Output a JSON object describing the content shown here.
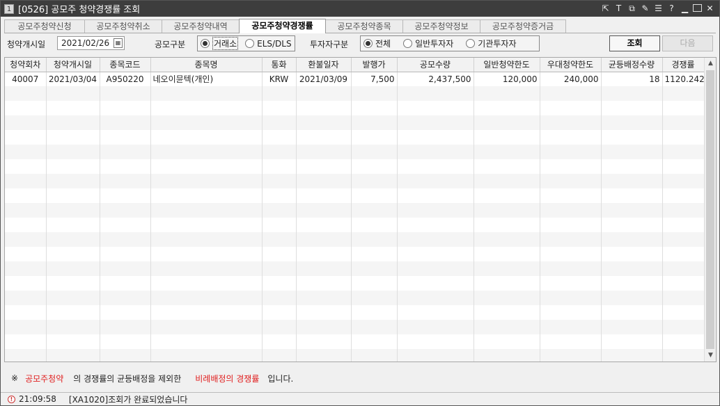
{
  "window": {
    "number": "1",
    "title": "[0526] 공모주 청약경쟁률 조회",
    "controls": [
      "link-out-icon",
      "text-icon",
      "copy-icon",
      "edit-icon",
      "list-icon",
      "help-icon",
      "minimize-icon",
      "maximize-icon",
      "close-icon"
    ]
  },
  "tabs": [
    {
      "label": "공모주청약신청",
      "active": false
    },
    {
      "label": "공모주청약취소",
      "active": false
    },
    {
      "label": "공모주청약내역",
      "active": false
    },
    {
      "label": "공모주청약경쟁률",
      "active": true
    },
    {
      "label": "공모주청약종목",
      "active": false
    },
    {
      "label": "공모주청약정보",
      "active": false
    },
    {
      "label": "공모주청약증거금",
      "active": false
    }
  ],
  "filters": {
    "start_date_label": "청약개시일",
    "start_date_value": "2021/02/26",
    "offer_type_label": "공모구분",
    "offer_type_options": [
      {
        "label": "거래소",
        "selected": true
      },
      {
        "label": "ELS/DLS",
        "selected": false
      }
    ],
    "investor_type_label": "투자자구분",
    "investor_type_options": [
      {
        "label": "전체",
        "selected": true
      },
      {
        "label": "일반투자자",
        "selected": false
      },
      {
        "label": "기관투자자",
        "selected": false
      }
    ],
    "search_button": "조회",
    "next_button": "다음"
  },
  "grid": {
    "columns": [
      "청약회차",
      "청약개시일",
      "종목코드",
      "종목명",
      "통화",
      "환불일자",
      "발행가",
      "공모수량",
      "일반청약한도",
      "우대청약한도",
      "균등배정수량",
      "경쟁률"
    ],
    "rows": [
      [
        "40007",
        "2021/03/04",
        "A950220",
        "네오이뮨텍(개인)",
        "KRW",
        "2021/03/09",
        "7,500",
        "2,437,500",
        "120,000",
        "240,000",
        "18",
        "1120.242"
      ]
    ]
  },
  "notice": {
    "mark": "※",
    "part1": "공모주청약",
    "part2": "의 경쟁률의 균등배정을 제외한",
    "part3": "비례배정의 경쟁률",
    "part4": "입니다."
  },
  "status": {
    "time": "21:09:58",
    "message": "[XA1020]조회가 완료되었습니다"
  },
  "colors": {
    "titlebar": "#3d3d3d",
    "highlight_text": "#e02020",
    "row_alt": "#f5f5f5"
  }
}
